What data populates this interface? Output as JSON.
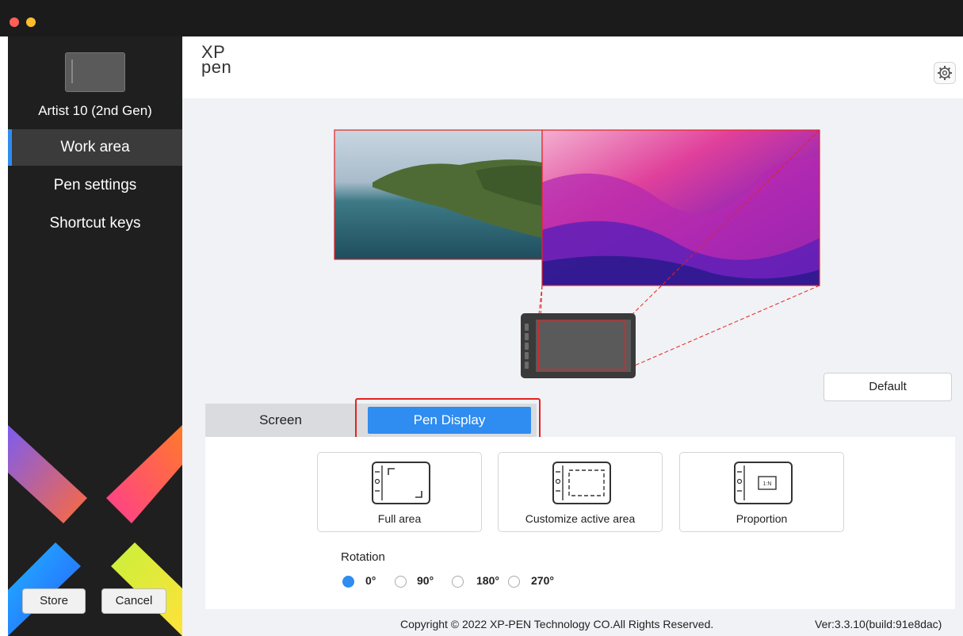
{
  "colors": {
    "accent": "#2f8cf0",
    "highlight_red": "#e52222",
    "sidebar_bg": "#1f1f1f",
    "close": "#ff5f57",
    "minimize": "#febc2e"
  },
  "window": {
    "controls": [
      "close",
      "minimize"
    ]
  },
  "sidebar": {
    "device_name": "Artist 10 (2nd Gen)",
    "items": [
      {
        "label": "Work area",
        "active": true
      },
      {
        "label": "Pen settings",
        "active": false
      },
      {
        "label": "Shortcut keys",
        "active": false
      }
    ],
    "store_label": "Store",
    "cancel_label": "Cancel"
  },
  "header": {
    "logo_line1": "XP",
    "logo_line2": "pen",
    "settings_icon": "gear-icon"
  },
  "workarea": {
    "monitors": [
      "landscape-photo",
      "macos-wallpaper"
    ],
    "default_label": "Default"
  },
  "tabs": {
    "screen_label": "Screen",
    "pen_display_label": "Pen Display",
    "active": "Pen Display"
  },
  "area_options": [
    {
      "label": "Full area",
      "icon": "full-area-icon"
    },
    {
      "label": "Customize active area",
      "icon": "custom-area-icon"
    },
    {
      "label": "Proportion",
      "icon": "proportion-icon",
      "icon_text": "1:N"
    }
  ],
  "rotation": {
    "title": "Rotation",
    "options": [
      "0°",
      "90°",
      "180°",
      "270°"
    ],
    "selected": "0°"
  },
  "footer": {
    "copyright": "Copyright © 2022  XP-PEN Technology CO.All Rights Reserved.",
    "version": "Ver:3.3.10(build:91e8dac)"
  }
}
